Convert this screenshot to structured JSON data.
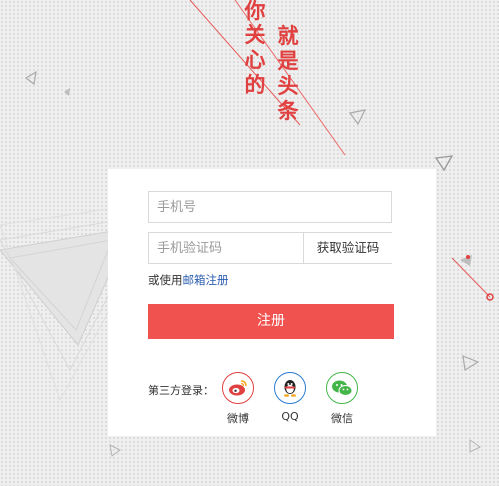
{
  "slogan": {
    "col1": [
      "你",
      "关",
      "心",
      "的"
    ],
    "col2": [
      "就",
      "是",
      "头",
      "条"
    ]
  },
  "form": {
    "phone_placeholder": "手机号",
    "code_placeholder": "手机验证码",
    "get_code_label": "获取验证码",
    "alt_prefix": "或使用",
    "alt_link": "邮箱注册",
    "submit_label": "注册"
  },
  "third_party": {
    "label": "第三方登录：",
    "items": [
      {
        "name": "微博",
        "icon": "weibo-icon",
        "color": "#e0403f"
      },
      {
        "name": "QQ",
        "icon": "qq-icon",
        "color": "#2a7bd0"
      },
      {
        "name": "微信",
        "icon": "wechat-icon",
        "color": "#44b549"
      }
    ]
  },
  "colors": {
    "accent": "#f0524f",
    "slogan": "#e0403f",
    "link": "#2a5db0"
  }
}
